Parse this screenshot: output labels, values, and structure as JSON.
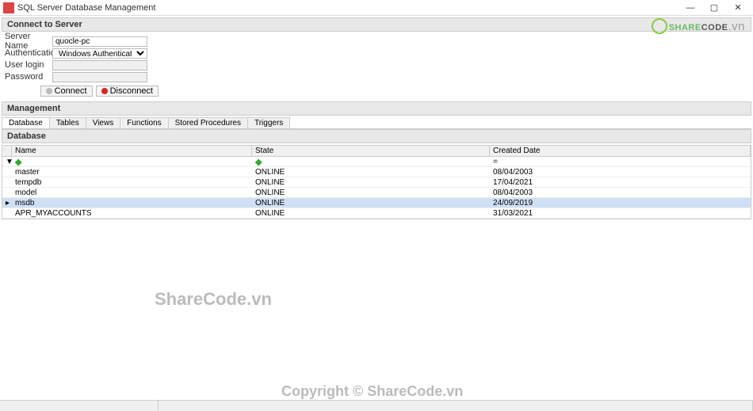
{
  "window": {
    "title": "SQL Server Database Management"
  },
  "sections": {
    "connect_header": "Connect to Server",
    "management_header": "Management",
    "database_header": "Database"
  },
  "form": {
    "server_name_label": "Server Name",
    "server_name_value": "quocle-pc",
    "auth_label": "Authentication",
    "auth_value": "Windows Authentication",
    "user_label": "User login",
    "user_value": "",
    "password_label": "Password",
    "password_value": ""
  },
  "buttons": {
    "connect": "Connect",
    "disconnect": "Disconnect"
  },
  "tabs": [
    "Database",
    "Tables",
    "Views",
    "Functions",
    "Stored Procedures",
    "Triggers"
  ],
  "active_tab": 0,
  "grid": {
    "columns": [
      "Name",
      "State",
      "Created Date"
    ],
    "rows": [
      {
        "name": "master",
        "state": "ONLINE",
        "created": "08/04/2003",
        "selected": false
      },
      {
        "name": "tempdb",
        "state": "ONLINE",
        "created": "17/04/2021",
        "selected": false
      },
      {
        "name": "model",
        "state": "ONLINE",
        "created": "08/04/2003",
        "selected": false
      },
      {
        "name": "msdb",
        "state": "ONLINE",
        "created": "24/09/2019",
        "selected": true
      },
      {
        "name": "APR_MYACCOUNTS",
        "state": "ONLINE",
        "created": "31/03/2021",
        "selected": false
      }
    ]
  },
  "watermarks": {
    "mid": "ShareCode.vn",
    "bottom": "Copyright © ShareCode.vn",
    "logo_main": "SHARE",
    "logo_sub": "CODE",
    "logo_ext": ".vn"
  }
}
